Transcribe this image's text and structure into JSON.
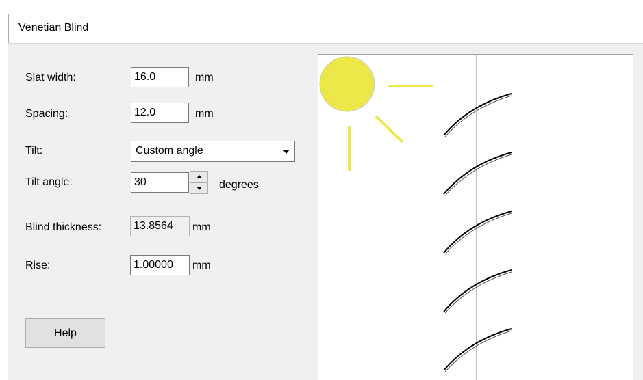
{
  "tabs": [
    {
      "label": "Venetian Blind",
      "active": true
    }
  ],
  "form": {
    "slat_width": {
      "label": "Slat width:",
      "value": "16.0",
      "unit": "mm"
    },
    "spacing": {
      "label": "Spacing:",
      "value": "12.0",
      "unit": "mm"
    },
    "tilt": {
      "label": "Tilt:",
      "selected": "Custom angle"
    },
    "tilt_angle": {
      "label": "Tilt angle:",
      "value": "30",
      "unit": "degrees"
    },
    "blind_thickness": {
      "label": "Blind thickness:",
      "value": "13.8564",
      "unit": "mm"
    },
    "rise": {
      "label": "Rise:",
      "value": "1.00000",
      "unit": "mm"
    }
  },
  "buttons": {
    "help": "Help"
  },
  "colors": {
    "sun": "#ede84a",
    "panel": "#f0f0f0"
  }
}
